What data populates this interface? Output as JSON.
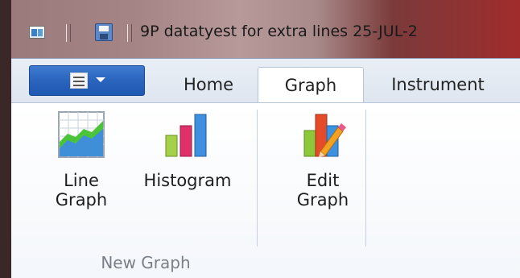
{
  "window": {
    "title": "9P datatyest for extra lines 25-JUL-2"
  },
  "ribbon": {
    "tabs": [
      {
        "label": "Home",
        "active": false
      },
      {
        "label": "Graph",
        "active": true
      },
      {
        "label": "Instrument",
        "active": false
      }
    ],
    "groups": [
      {
        "label": "New Graph",
        "buttons": [
          {
            "label_line1": "Line",
            "label_line2": "Graph",
            "icon": "line-graph-icon"
          },
          {
            "label_line1": "Histogram",
            "icon": "histogram-icon"
          }
        ]
      },
      {
        "label": "",
        "buttons": [
          {
            "label_line1": "Edit",
            "label_line2": "Graph",
            "icon": "edit-graph-icon"
          }
        ]
      }
    ]
  },
  "colors": {
    "accent": "#2a64bd",
    "ribbon_bg": "#ffffff",
    "tab_strip": "#e3e9f2"
  }
}
